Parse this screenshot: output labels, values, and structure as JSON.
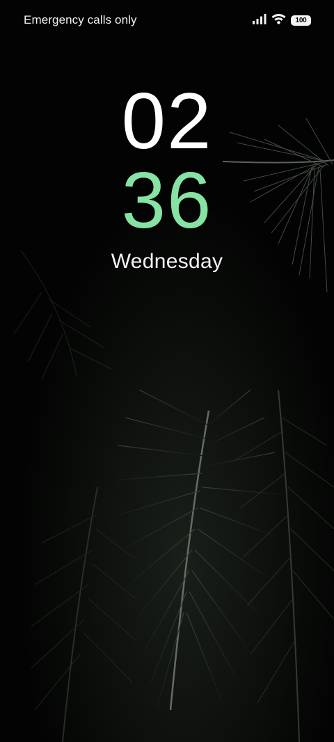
{
  "status_bar": {
    "carrier_text": "Emergency calls only",
    "battery_level": "100",
    "signal_icon": "cellular-signal-icon",
    "wifi_icon": "wifi-icon"
  },
  "lock_clock": {
    "hours": "02",
    "minutes": "36",
    "day": "Wednesday",
    "hours_color": "#ffffff",
    "minutes_color": "#86e3a3"
  },
  "wallpaper": {
    "subject": "dark palm fronds"
  }
}
